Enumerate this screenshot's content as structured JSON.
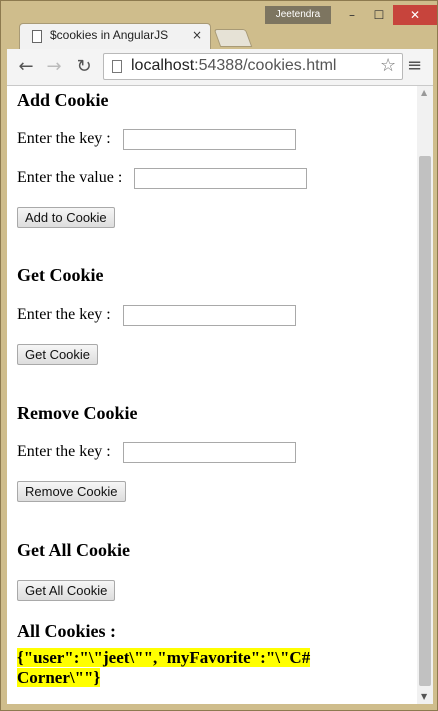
{
  "browser": {
    "user_badge": "Jeetendra",
    "tab_title": "$cookies in AngularJS",
    "tab_close": "×",
    "url_host": "localhost",
    "url_rest": ":54388/cookies.html",
    "window_buttons": {
      "minimize": "–",
      "maximize": "☐",
      "close": "✕"
    }
  },
  "sections": {
    "add": {
      "heading": "Add Cookie",
      "key_label": "Enter the key :",
      "key_value": "",
      "value_label": "Enter the value :",
      "value_value": "",
      "button": "Add to Cookie"
    },
    "get": {
      "heading": "Get Cookie",
      "key_label": "Enter the key :",
      "key_value": "",
      "button": "Get Cookie"
    },
    "remove": {
      "heading": "Remove Cookie",
      "key_label": "Enter the key :",
      "key_value": "",
      "button": "Remove Cookie"
    },
    "all": {
      "heading": "Get All Cookie",
      "button": "Get All Cookie",
      "result_label": "All Cookies :",
      "result_value": "{\"user\":\"\\\"jeet\\\"\",\"myFavorite\":\"\\\"C# Corner\\\"\"}"
    }
  },
  "colors": {
    "highlight": "#ffff00",
    "close_button": "#c7443c"
  }
}
